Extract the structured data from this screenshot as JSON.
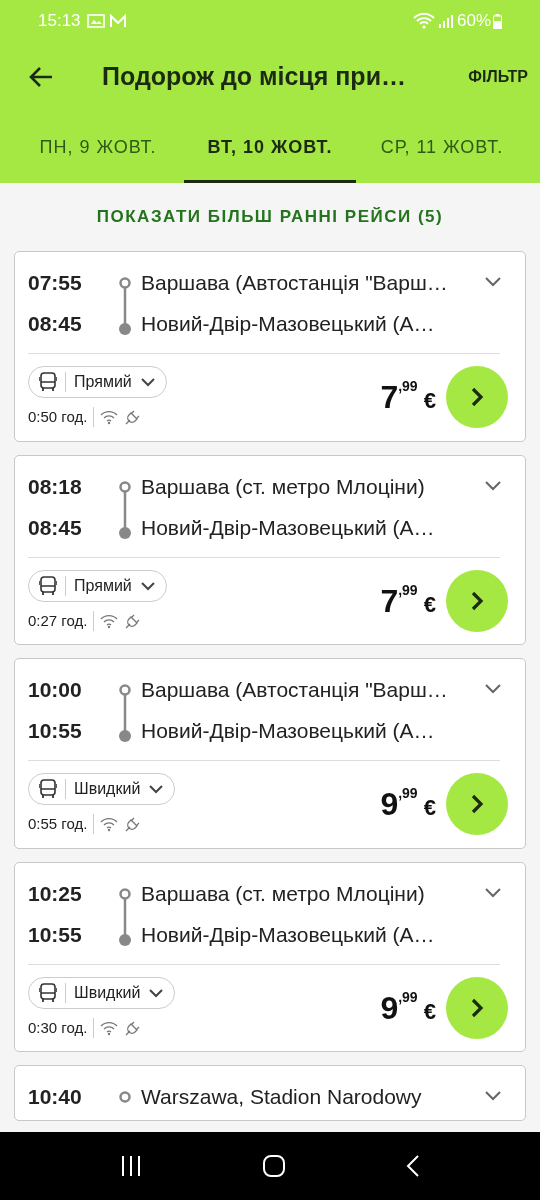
{
  "status_bar": {
    "time": "15:13",
    "battery": "60%"
  },
  "app_bar": {
    "title": "Подорож до місця при…",
    "action": "ФІЛЬТР"
  },
  "tabs": [
    {
      "label": "ПН, 9 ЖОВТ.",
      "selected": false
    },
    {
      "label": "ВТ, 10 ЖОВТ.",
      "selected": true
    },
    {
      "label": "СР, 11 ЖОВТ.",
      "selected": false
    }
  ],
  "earlier_link": "ПОКАЗАТИ БІЛЬШ РАННІ РЕЙСИ (5)",
  "trips": [
    {
      "departure": "07:55",
      "arrival": "08:45",
      "origin": "Варшава (Автостанція \"Варш…",
      "destination": "Новий-Двір-Мазовецький (А…",
      "type": "Прямий",
      "duration": "0:50 год.",
      "price": "7$^{,99}$ €"
    },
    {
      "departure": "08:18",
      "arrival": "08:45",
      "origin": "Варшава (ст. метро Млоціни)",
      "destination": "Новий-Двір-Мазовецький (А…",
      "type": "Прямий",
      "duration": "0:27 год.",
      "price": "7$^{,99}$ €"
    },
    {
      "departure": "10:00",
      "arrival": "10:55",
      "origin": "Варшава (Автостанція \"Варш…",
      "destination": "Новий-Двір-Мазовецький (А…",
      "type": "Швидкий",
      "duration": "0:55 год.",
      "price": "9$^{,99}$ €"
    },
    {
      "departure": "10:25",
      "arrival": "10:55",
      "origin": "Варшава (ст. метро Млоціни)",
      "destination": "Новий-Двір-Мазовецький (А…",
      "type": "Швидкий",
      "duration": "0:30 год.",
      "price": "9$^{,99}$ €"
    },
    {
      "departure": "10:40",
      "origin": "Warszawa, Stadion Narodowy"
    }
  ]
}
